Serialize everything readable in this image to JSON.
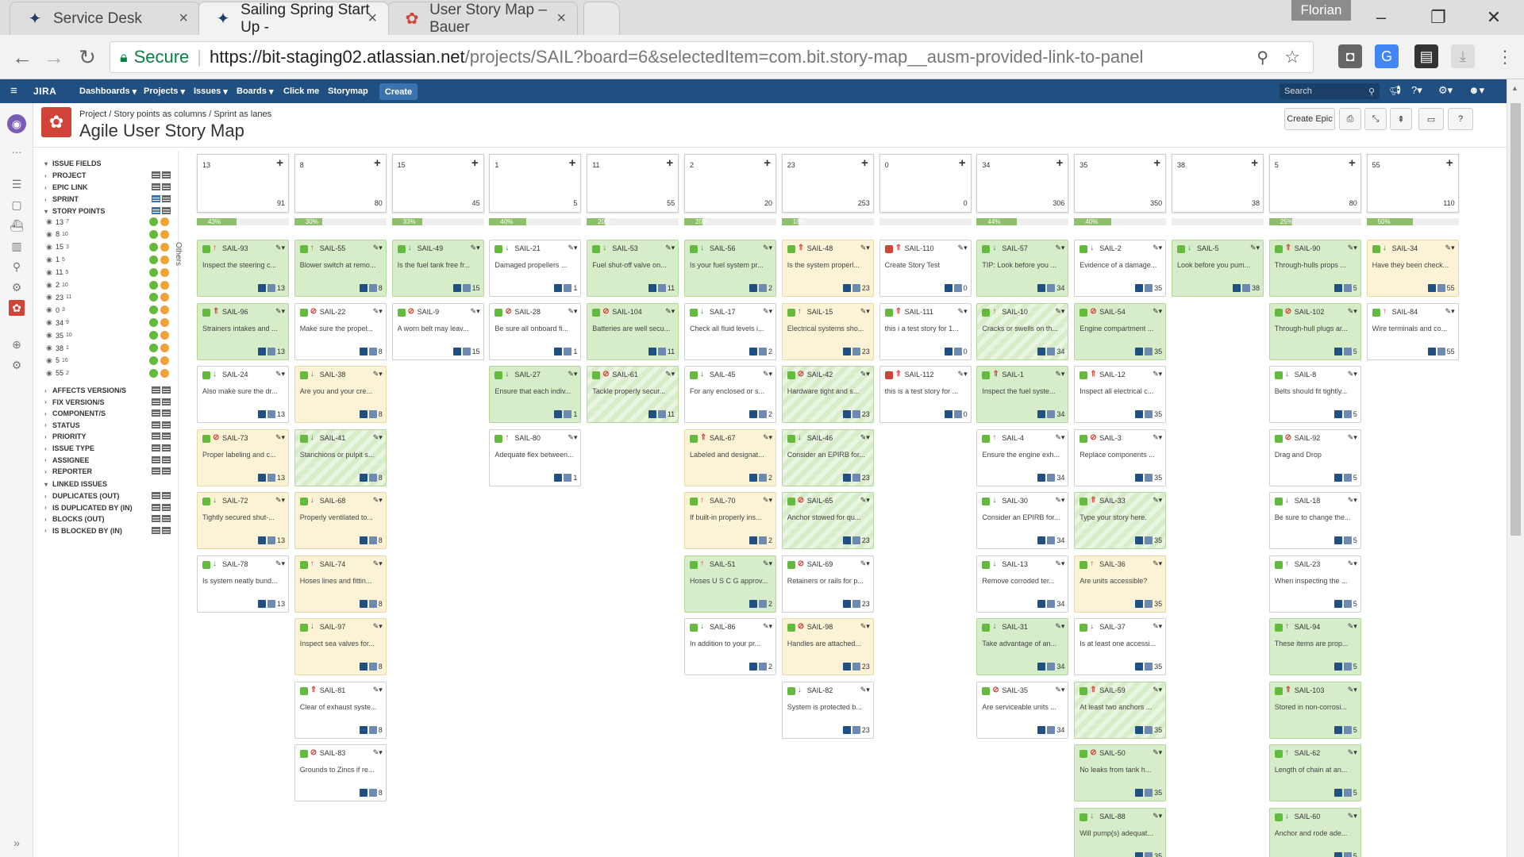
{
  "browser": {
    "tabs": [
      {
        "title": "Service Desk",
        "icon": "jira-service-desk-icon"
      },
      {
        "title": "Sailing Spring Start Up -",
        "icon": "jira-icon",
        "active": true
      },
      {
        "title": "User Story Map – Bauer",
        "icon": "story-map-icon"
      }
    ],
    "profile": "Florian",
    "secure_label": "Secure",
    "url_host": "https://bit-staging02.atlassian.net",
    "url_path": "/projects/SAIL?board=6&selectedItem=com.bit.story-map__ausm-provided-link-to-panel"
  },
  "jira": {
    "logo": "JIRA",
    "menus": [
      "Dashboards",
      "Projects",
      "Issues",
      "Boards",
      "Click me",
      "Storymap"
    ],
    "create": "Create",
    "search_placeholder": "Search"
  },
  "page": {
    "breadcrumb": "Project / Story points as columns / Sprint as lanes",
    "title": "Agile User Story Map",
    "create_epic": "Create Epic"
  },
  "fields": {
    "issue_fields": "ISSUE FIELDS",
    "top": [
      "PROJECT",
      "EPIC LINK",
      "SPRINT",
      "STORY POINTS"
    ],
    "story_points": [
      {
        "label": "13",
        "count": "7"
      },
      {
        "label": "8",
        "count": "10"
      },
      {
        "label": "15",
        "count": "3"
      },
      {
        "label": "1",
        "count": "5"
      },
      {
        "label": "11",
        "count": "5"
      },
      {
        "label": "2",
        "count": "10"
      },
      {
        "label": "23",
        "count": "11"
      },
      {
        "label": "0",
        "count": "3"
      },
      {
        "label": "34",
        "count": "9"
      },
      {
        "label": "35",
        "count": "10"
      },
      {
        "label": "38",
        "count": "1"
      },
      {
        "label": "5",
        "count": "16"
      },
      {
        "label": "55",
        "count": "2"
      }
    ],
    "bottom": [
      "AFFECTS VERSION/S",
      "FIX VERSION/S",
      "COMPONENT/S",
      "STATUS",
      "PRIORITY",
      "ISSUE TYPE",
      "ASSIGNEE",
      "REPORTER"
    ],
    "linked": "LINKED ISSUES",
    "linked_items": [
      "DUPLICATES (OUT)",
      "IS DUPLICATED BY (IN)",
      "BLOCKS (OUT)",
      "IS BLOCKED BY (IN)"
    ],
    "others": "Others"
  },
  "columns": [
    {
      "header": "13",
      "total": "91",
      "progress": 43,
      "progress_label": "43%"
    },
    {
      "header": "8",
      "total": "80",
      "progress": 30,
      "progress_label": "30%"
    },
    {
      "header": "15",
      "total": "45",
      "progress": 33,
      "progress_label": "33%"
    },
    {
      "header": "1",
      "total": "5",
      "progress": 40,
      "progress_label": "40%"
    },
    {
      "header": "11",
      "total": "55",
      "progress": 20,
      "progress_label": "20%"
    },
    {
      "header": "2",
      "total": "20",
      "progress": 20,
      "progress_label": "20%"
    },
    {
      "header": "23",
      "total": "253",
      "progress": 18,
      "progress_label": "18%"
    },
    {
      "header": "0",
      "total": "0",
      "progress": 0,
      "progress_label": "0%"
    },
    {
      "header": "34",
      "total": "306",
      "progress": 44,
      "progress_label": "44%"
    },
    {
      "header": "35",
      "total": "350",
      "progress": 40,
      "progress_label": "40%"
    },
    {
      "header": "38",
      "total": "38",
      "progress": 0,
      "progress_label": "0%"
    },
    {
      "header": "5",
      "total": "80",
      "progress": 25,
      "progress_label": "25%"
    },
    {
      "header": "55",
      "total": "110",
      "progress": 50,
      "progress_label": "50%"
    }
  ],
  "cards": [
    [
      {
        "key": "SAIL-93",
        "summary": "Inspect the steering c...",
        "points": "13",
        "status": "done",
        "priority": "high",
        "stripe": false
      },
      {
        "key": "SAIL-96",
        "summary": "Strainers intakes and ...",
        "points": "13",
        "status": "done",
        "priority": "highest",
        "stripe": false
      },
      {
        "key": "SAIL-24",
        "summary": "Also make sure the dr...",
        "points": "13",
        "status": "todo",
        "priority": "low",
        "stripe": false
      },
      {
        "key": "SAIL-73",
        "summary": "Proper labeling and c...",
        "points": "13",
        "status": "prog",
        "priority": "blocker",
        "stripe": false
      },
      {
        "key": "SAIL-72",
        "summary": "Tightly secured shut-...",
        "points": "13",
        "status": "prog",
        "priority": "low",
        "stripe": false
      },
      {
        "key": "SAIL-78",
        "summary": "Is system neatly bund...",
        "points": "13",
        "status": "todo",
        "priority": "low",
        "stripe": false
      }
    ],
    [
      {
        "key": "SAIL-55",
        "summary": "Blower switch at remo...",
        "points": "8",
        "status": "done",
        "priority": "high",
        "stripe": false
      },
      {
        "key": "SAIL-22",
        "summary": "Make sure the propel...",
        "points": "8",
        "status": "todo",
        "priority": "blocker",
        "stripe": false
      },
      {
        "key": "SAIL-38",
        "summary": "Are you and your cre...",
        "points": "8",
        "status": "prog",
        "priority": "low",
        "stripe": false
      },
      {
        "key": "SAIL-41",
        "summary": "Stanchions or pulpit s...",
        "points": "8",
        "status": "done",
        "priority": "low",
        "stripe": true
      },
      {
        "key": "SAIL-68",
        "summary": "Properly ventilated to...",
        "points": "8",
        "status": "prog",
        "priority": "low",
        "stripe": false
      },
      {
        "key": "SAIL-74",
        "summary": "Hoses lines and fittin...",
        "points": "8",
        "status": "prog",
        "priority": "high",
        "stripe": false
      },
      {
        "key": "SAIL-97",
        "summary": "Inspect sea valves for...",
        "points": "8",
        "status": "prog",
        "priority": "low",
        "stripe": false
      },
      {
        "key": "SAIL-81",
        "summary": "Clear of exhaust syste...",
        "points": "8",
        "status": "todo",
        "priority": "highest",
        "stripe": false
      },
      {
        "key": "SAIL-83",
        "summary": "Grounds to Zincs if re...",
        "points": "8",
        "status": "todo",
        "priority": "blocker",
        "stripe": false
      }
    ],
    [
      {
        "key": "SAIL-49",
        "summary": "Is the fuel tank free fr...",
        "points": "15",
        "status": "done",
        "priority": "low",
        "stripe": false
      },
      {
        "key": "SAIL-9",
        "summary": "A worn belt may leav...",
        "points": "15",
        "status": "todo",
        "priority": "blocker",
        "stripe": false
      }
    ],
    [
      {
        "key": "SAIL-21",
        "summary": "Damaged propellers ...",
        "points": "1",
        "status": "todo",
        "priority": "low",
        "stripe": false
      },
      {
        "key": "SAIL-28",
        "summary": "Be sure all onboard fi...",
        "points": "1",
        "status": "todo",
        "priority": "blocker",
        "stripe": false
      },
      {
        "key": "SAIL-27",
        "summary": "Ensure that each indiv...",
        "points": "1",
        "status": "done",
        "priority": "low",
        "stripe": false
      },
      {
        "key": "SAIL-80",
        "summary": "Adequate flex between...",
        "points": "1",
        "status": "todo",
        "priority": "high",
        "stripe": false
      }
    ],
    [
      {
        "key": "SAIL-53",
        "summary": "Fuel shut-off valve on...",
        "points": "11",
        "status": "done",
        "priority": "low",
        "stripe": false
      },
      {
        "key": "SAIL-104",
        "summary": "Batteries are well secu...",
        "points": "11",
        "status": "done",
        "priority": "blocker",
        "stripe": false
      },
      {
        "key": "SAIL-61",
        "summary": "Tackle properly secur...",
        "points": "11",
        "status": "done",
        "priority": "blocker",
        "stripe": true
      }
    ],
    [
      {
        "key": "SAIL-56",
        "summary": "Is your fuel system pr...",
        "points": "2",
        "status": "done",
        "priority": "low",
        "stripe": false
      },
      {
        "key": "SAIL-17",
        "summary": "Check all fluid levels i...",
        "points": "2",
        "status": "todo",
        "priority": "low",
        "stripe": false
      },
      {
        "key": "SAIL-45",
        "summary": "For any enclosed or s...",
        "points": "2",
        "status": "todo",
        "priority": "low",
        "stripe": false
      },
      {
        "key": "SAIL-67",
        "summary": "Labeled and designat...",
        "points": "2",
        "status": "prog",
        "priority": "highest",
        "stripe": false
      },
      {
        "key": "SAIL-70",
        "summary": "If built-in properly ins...",
        "points": "2",
        "status": "prog",
        "priority": "high",
        "stripe": false
      },
      {
        "key": "SAIL-51",
        "summary": "Hoses U S C G approv...",
        "points": "2",
        "status": "done",
        "priority": "high",
        "stripe": false
      },
      {
        "key": "SAIL-86",
        "summary": "In addition to your pr...",
        "points": "2",
        "status": "todo",
        "priority": "low",
        "stripe": false
      }
    ],
    [
      {
        "key": "SAIL-48",
        "summary": "Is the system properl...",
        "points": "23",
        "status": "prog",
        "priority": "highest",
        "stripe": false
      },
      {
        "key": "SAIL-15",
        "summary": "Electrical systems sho...",
        "points": "23",
        "status": "prog",
        "priority": "high",
        "stripe": false
      },
      {
        "key": "SAIL-42",
        "summary": "Hardware tight and s...",
        "points": "23",
        "status": "done",
        "priority": "blocker",
        "stripe": true
      },
      {
        "key": "SAIL-46",
        "summary": "Consider an EPIRB for...",
        "points": "23",
        "status": "done",
        "priority": "low",
        "stripe": true
      },
      {
        "key": "SAIL-65",
        "summary": "Anchor stowed for qu...",
        "points": "23",
        "status": "done",
        "priority": "blocker",
        "stripe": true
      },
      {
        "key": "SAIL-69",
        "summary": "Retainers or rails for p...",
        "points": "23",
        "status": "todo",
        "priority": "blocker",
        "stripe": false
      },
      {
        "key": "SAIL-98",
        "summary": "Handles are attached...",
        "points": "23",
        "status": "prog",
        "priority": "blocker",
        "stripe": false
      },
      {
        "key": "SAIL-82",
        "summary": "System is protected b...",
        "points": "23",
        "status": "todo",
        "priority": "low",
        "stripe": false
      }
    ],
    [
      {
        "key": "SAIL-110",
        "summary": "Create Story Test",
        "points": "0",
        "status": "todo",
        "priority": "highest",
        "stripe": false,
        "bug": true
      },
      {
        "key": "SAIL-111",
        "summary": "this i a test story for 1...",
        "points": "0",
        "status": "todo",
        "priority": "highest",
        "stripe": false
      },
      {
        "key": "SAIL-112",
        "summary": "this is a test story for ...",
        "points": "0",
        "status": "todo",
        "priority": "highest",
        "stripe": false,
        "bug": true
      }
    ],
    [
      {
        "key": "SAIL-57",
        "summary": "TIP: Look before you ...",
        "points": "34",
        "status": "done",
        "priority": "low",
        "stripe": false
      },
      {
        "key": "SAIL-10",
        "summary": "Cracks or swells on th...",
        "points": "34",
        "status": "done",
        "priority": "high",
        "stripe": true
      },
      {
        "key": "SAIL-1",
        "summary": "Inspect the fuel syste...",
        "points": "34",
        "status": "done",
        "priority": "highest",
        "stripe": false
      },
      {
        "key": "SAIL-4",
        "summary": "Ensure the engine exh...",
        "points": "34",
        "status": "todo",
        "priority": "high",
        "stripe": false
      },
      {
        "key": "SAIL-30",
        "summary": "Consider an EPIRB for...",
        "points": "34",
        "status": "todo",
        "priority": "low",
        "stripe": false
      },
      {
        "key": "SAIL-13",
        "summary": "Remove corroded ter...",
        "points": "34",
        "status": "todo",
        "priority": "low",
        "stripe": false
      },
      {
        "key": "SAIL-31",
        "summary": "Take advantage of an...",
        "points": "34",
        "status": "done",
        "priority": "low",
        "stripe": false
      },
      {
        "key": "SAIL-35",
        "summary": "Are serviceable units ...",
        "points": "34",
        "status": "todo",
        "priority": "blocker",
        "stripe": false
      }
    ],
    [
      {
        "key": "SAIL-2",
        "summary": "Evidence of a damage...",
        "points": "35",
        "status": "todo",
        "priority": "low",
        "stripe": false
      },
      {
        "key": "SAIL-54",
        "summary": "Engine compartment ...",
        "points": "35",
        "status": "done",
        "priority": "blocker",
        "stripe": false
      },
      {
        "key": "SAIL-12",
        "summary": "Inspect all electrical c...",
        "points": "35",
        "status": "todo",
        "priority": "highest",
        "stripe": false
      },
      {
        "key": "SAIL-3",
        "summary": "Replace components ...",
        "points": "35",
        "status": "todo",
        "priority": "blocker",
        "stripe": false
      },
      {
        "key": "SAIL-33",
        "summary": "Type your story here.",
        "points": "35",
        "status": "done",
        "priority": "highest",
        "stripe": true
      },
      {
        "key": "SAIL-36",
        "summary": "Are units accessible?",
        "points": "35",
        "status": "prog",
        "priority": "high",
        "stripe": false
      },
      {
        "key": "SAIL-37",
        "summary": "Is at least one accessi...",
        "points": "35",
        "status": "todo",
        "priority": "low",
        "stripe": false
      },
      {
        "key": "SAIL-59",
        "summary": "At least two anchors ...",
        "points": "35",
        "status": "done",
        "priority": "highest",
        "stripe": true
      },
      {
        "key": "SAIL-50",
        "summary": "No leaks from tank h...",
        "points": "35",
        "status": "done",
        "priority": "blocker",
        "stripe": false
      },
      {
        "key": "SAIL-88",
        "summary": "Will pump(s) adequat...",
        "points": "35",
        "status": "done",
        "priority": "low",
        "stripe": false
      }
    ],
    [
      {
        "key": "SAIL-5",
        "summary": "Look before you pum...",
        "points": "38",
        "status": "done",
        "priority": "low",
        "stripe": false
      }
    ],
    [
      {
        "key": "SAIL-90",
        "summary": "Through-hulls props ...",
        "points": "5",
        "status": "done",
        "priority": "highest",
        "stripe": false
      },
      {
        "key": "SAIL-102",
        "summary": "Through-hull plugs ar...",
        "points": "5",
        "status": "done",
        "priority": "blocker",
        "stripe": false
      },
      {
        "key": "SAIL-8",
        "summary": "Belts should fit tightly...",
        "points": "5",
        "status": "todo",
        "priority": "low",
        "stripe": false
      },
      {
        "key": "SAIL-92",
        "summary": "Drag and Drop",
        "points": "5",
        "status": "todo",
        "priority": "blocker",
        "stripe": false
      },
      {
        "key": "SAIL-18",
        "summary": "Be sure to change the...",
        "points": "5",
        "status": "todo",
        "priority": "low",
        "stripe": false
      },
      {
        "key": "SAIL-23",
        "summary": "When inspecting the ...",
        "points": "5",
        "status": "todo",
        "priority": "high",
        "stripe": false
      },
      {
        "key": "SAIL-94",
        "summary": "These items are prop...",
        "points": "5",
        "status": "done",
        "priority": "high",
        "stripe": false
      },
      {
        "key": "SAIL-103",
        "summary": "Stored in non-corrosi...",
        "points": "5",
        "status": "done",
        "priority": "highest",
        "stripe": false
      },
      {
        "key": "SAIL-62",
        "summary": "Length of chain at an...",
        "points": "5",
        "status": "done",
        "priority": "high",
        "stripe": false
      },
      {
        "key": "SAIL-60",
        "summary": "Anchor and rode ade...",
        "points": "5",
        "status": "done",
        "priority": "low",
        "stripe": false
      }
    ],
    [
      {
        "key": "SAIL-34",
        "summary": "Have they been check...",
        "points": "55",
        "status": "prog",
        "priority": "low",
        "stripe": false
      },
      {
        "key": "SAIL-84",
        "summary": "Wire terminals and co...",
        "points": "55",
        "status": "todo",
        "priority": "high",
        "stripe": false
      }
    ]
  ],
  "colors": {
    "jira_nav": "#205081",
    "done": "#d7ecc9",
    "in_progress": "#fcf3d6",
    "progress_fill": "#8ec06b",
    "dot_green": "#63ba3c",
    "dot_orange": "#f0a23a",
    "priority_high": "#d04437",
    "priority_low": "#2a8735"
  }
}
